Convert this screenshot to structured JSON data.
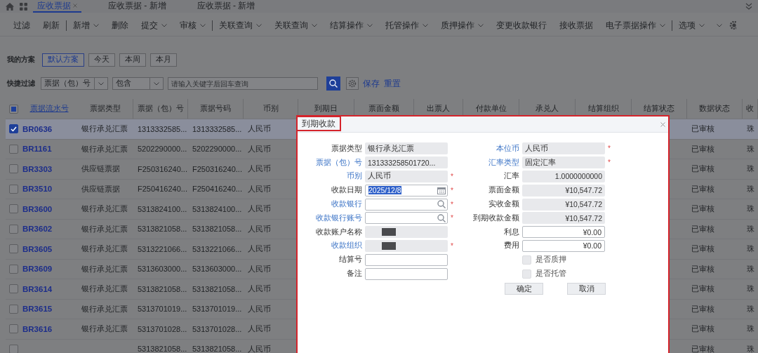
{
  "tabs": [
    {
      "label": "应收票据",
      "selected": true,
      "closable": true
    },
    {
      "label": "应收票据 - 新增",
      "selected": false,
      "closable": false
    },
    {
      "label": "应收票据 - 新增",
      "selected": false,
      "closable": false
    }
  ],
  "toolbar": [
    {
      "label": "过滤",
      "dropdown": false,
      "divider_before": false
    },
    {
      "label": "刷新",
      "dropdown": false,
      "divider_before": false
    },
    {
      "label": "新增",
      "dropdown": true,
      "divider_before": true
    },
    {
      "label": "删除",
      "dropdown": false,
      "divider_before": false
    },
    {
      "label": "提交",
      "dropdown": true,
      "divider_before": false
    },
    {
      "label": "审核",
      "dropdown": true,
      "divider_before": false
    },
    {
      "label": "关联查询",
      "dropdown": true,
      "divider_before": true
    },
    {
      "label": "关联查询",
      "dropdown": true,
      "divider_before": false
    },
    {
      "label": "结算操作",
      "dropdown": true,
      "divider_before": false
    },
    {
      "label": "托管操作",
      "dropdown": true,
      "divider_before": false
    },
    {
      "label": "质押操作",
      "dropdown": true,
      "divider_before": false
    },
    {
      "label": "变更收款银行",
      "dropdown": false,
      "divider_before": false
    },
    {
      "label": "接收票据",
      "dropdown": false,
      "divider_before": false
    },
    {
      "label": "电子票据操作",
      "dropdown": true,
      "divider_before": false
    },
    {
      "label": "选项",
      "dropdown": true,
      "divider_before": true
    }
  ],
  "schemes": {
    "label": "我的方案",
    "items": [
      {
        "label": "默认方案",
        "selected": true
      },
      {
        "label": "今天",
        "selected": false
      },
      {
        "label": "本周",
        "selected": false
      },
      {
        "label": "本月",
        "selected": false
      }
    ]
  },
  "quick_filter": {
    "label": "快捷过滤",
    "field": "票据（包）号",
    "operator": "包含",
    "placeholder": "请输入关键字后回车查询",
    "save": "保存",
    "reset": "重置"
  },
  "table": {
    "select_all": {
      "checked": false,
      "indeterminate": true
    },
    "columns": [
      {
        "label": "票据流水号",
        "link": true
      },
      {
        "label": "票据类型",
        "link": false
      },
      {
        "label": "票据（包）号",
        "link": false
      },
      {
        "label": "票据号码",
        "link": false
      },
      {
        "label": "币别",
        "link": false
      },
      {
        "label": "到期日",
        "link": false
      },
      {
        "label": "票面金额",
        "link": false
      },
      {
        "label": "出票人",
        "link": false
      },
      {
        "label": "付款单位",
        "link": false
      },
      {
        "label": "承兑人",
        "link": false
      },
      {
        "label": "结算组织",
        "link": false
      },
      {
        "label": "结算状态",
        "link": false
      },
      {
        "label": "数据状态",
        "link": false
      },
      {
        "label": "收",
        "link": false
      }
    ],
    "rows": [
      {
        "checked": true,
        "selected": true,
        "serial": "BR0636",
        "type": "银行承兑汇票",
        "package_no": "1313332585...",
        "bill_no": "1313332585...",
        "currency": "人民币",
        "data_status": "已审核",
        "column_14": "珠"
      },
      {
        "checked": false,
        "selected": false,
        "serial": "BR1161",
        "type": "银行承兑汇票",
        "package_no": "5202290000...",
        "bill_no": "5202290000...",
        "currency": "人民币",
        "data_status": "已审核",
        "column_14": "珠"
      },
      {
        "checked": false,
        "selected": false,
        "serial": "BR3303",
        "type": "供应链票据",
        "package_no": "F250316240...",
        "bill_no": "F250316240...",
        "currency": "人民币",
        "data_status": "已审核",
        "column_14": "珠"
      },
      {
        "checked": false,
        "selected": false,
        "serial": "BR3510",
        "type": "供应链票据",
        "package_no": "F250416240...",
        "bill_no": "F250416240...",
        "currency": "人民币",
        "data_status": "已审核",
        "column_14": "珠"
      },
      {
        "checked": false,
        "selected": false,
        "serial": "BR3600",
        "type": "银行承兑汇票",
        "package_no": "5313824100...",
        "bill_no": "5313824100...",
        "currency": "人民币",
        "data_status": "已审核",
        "column_14": "珠"
      },
      {
        "checked": false,
        "selected": false,
        "serial": "BR3602",
        "type": "银行承兑汇票",
        "package_no": "5313821058...",
        "bill_no": "5313821058...",
        "currency": "人民币",
        "data_status": "已审核",
        "column_14": "珠"
      },
      {
        "checked": false,
        "selected": false,
        "serial": "BR3605",
        "type": "银行承兑汇票",
        "package_no": "5313221066...",
        "bill_no": "5313221066...",
        "currency": "人民币",
        "data_status": "已审核",
        "column_14": "珠"
      },
      {
        "checked": false,
        "selected": false,
        "serial": "BR3609",
        "type": "银行承兑汇票",
        "package_no": "5313603000...",
        "bill_no": "5313603000...",
        "currency": "人民币",
        "data_status": "已审核",
        "column_14": "珠"
      },
      {
        "checked": false,
        "selected": false,
        "serial": "BR3614",
        "type": "银行承兑汇票",
        "package_no": "5313821058...",
        "bill_no": "5313821058...",
        "currency": "人民币",
        "data_status": "已审核",
        "column_14": "珠"
      },
      {
        "checked": false,
        "selected": false,
        "serial": "BR3615",
        "type": "银行承兑汇票",
        "package_no": "5313701019...",
        "bill_no": "5313701019...",
        "currency": "人民币",
        "data_status": "已审核",
        "column_14": "珠"
      },
      {
        "checked": false,
        "selected": false,
        "serial": "BR3616",
        "type": "银行承兑汇票",
        "package_no": "5313701028...",
        "bill_no": "5313701028...",
        "currency": "人民币",
        "data_status": "已审核",
        "column_14": "珠"
      },
      {
        "checked": false,
        "selected": false,
        "package_no": "5313821058...",
        "bill_no": "5313821058...",
        "currency": "人民币",
        "data_status": "已审核",
        "column_14": "珠"
      }
    ]
  },
  "dialog": {
    "title": "到期收款",
    "left_fields": [
      {
        "label": "票据类型",
        "kind": "readonly",
        "value": "银行承兑汇票",
        "link": false
      },
      {
        "label": "票据（包）号",
        "kind": "readonly",
        "value": "131333258501720...",
        "link": true
      },
      {
        "label": "币别",
        "kind": "readonly",
        "value": "人民币",
        "link": true,
        "required_mark": "*"
      },
      {
        "label": "收款日期",
        "kind": "date",
        "value": "2025/12/8",
        "link": false,
        "required_mark": "*"
      },
      {
        "label": "收款银行",
        "kind": "lookup",
        "link": true,
        "required_mark": "*"
      },
      {
        "label": "收款银行账号",
        "kind": "lookup",
        "link": true,
        "required_mark": "*"
      },
      {
        "label": "收款账户名称",
        "kind": "redacted",
        "link": false
      },
      {
        "label": "收款组织",
        "kind": "redacted",
        "link": true,
        "required_mark": "*"
      },
      {
        "label": "结算号",
        "kind": "text",
        "link": false
      },
      {
        "label": "备注",
        "kind": "text",
        "link": false
      }
    ],
    "right_fields": [
      {
        "label": "本位币",
        "kind": "readonly",
        "value": "人民币",
        "link": true,
        "required_mark": "*"
      },
      {
        "label": "汇率类型",
        "kind": "readonly",
        "value": "固定汇率",
        "link": true,
        "required_mark": "*"
      },
      {
        "label": "汇率",
        "kind": "readonly_number",
        "value": "1.0000000000",
        "link": false
      },
      {
        "label": "票面金额",
        "kind": "readonly_number",
        "value": "¥10,547.72",
        "link": false
      },
      {
        "label": "实收金额",
        "kind": "readonly_number",
        "value": "¥10,547.72",
        "link": false
      },
      {
        "label": "到期收款金额",
        "kind": "readonly_number",
        "value": "¥10,547.72",
        "link": false
      },
      {
        "label": "利息",
        "kind": "number",
        "value": "¥0.00",
        "link": false
      },
      {
        "label": "费用",
        "kind": "number",
        "value": "¥0.00",
        "link": false
      }
    ],
    "checkboxes": [
      {
        "label": "是否质押",
        "checked": false,
        "disabled": true
      },
      {
        "label": "是否托管",
        "checked": false,
        "disabled": true
      }
    ],
    "buttons": [
      "确定",
      "取消"
    ]
  }
}
